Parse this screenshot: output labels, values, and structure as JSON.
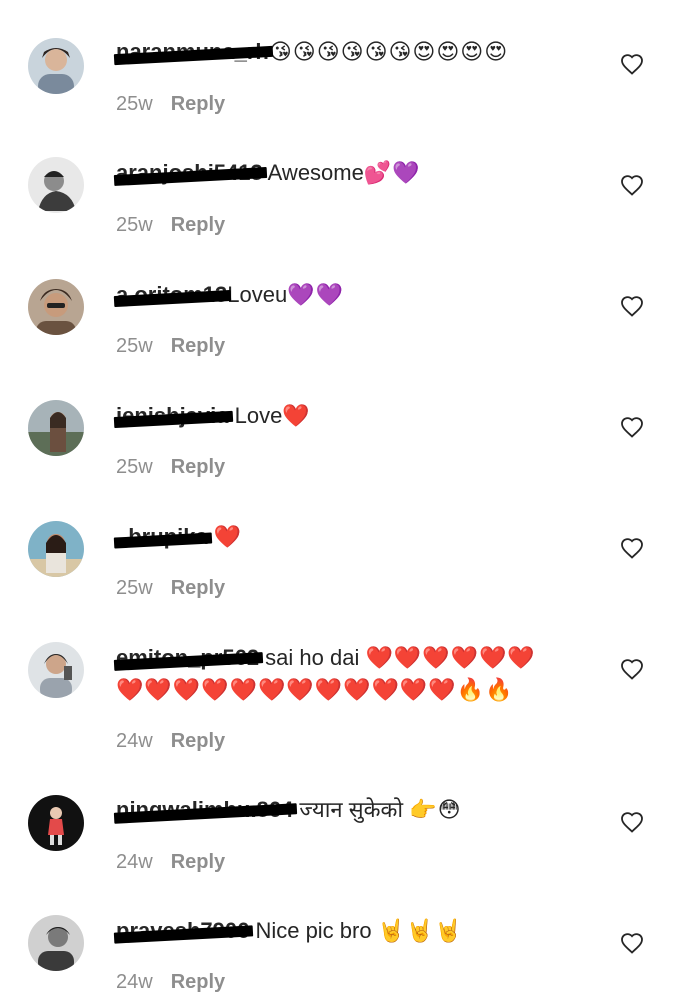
{
  "comments": [
    {
      "username": "naranmuna_rh",
      "text": "",
      "emoji": "😘😘😘😘😘😘😍😍😍😍",
      "time": "25w",
      "reply": "Reply",
      "avatar_color": "#7a8a9c"
    },
    {
      "username": "aranjoshi5413",
      "text": " Awesome",
      "emoji": "💕💜",
      "time": "25w",
      "reply": "Reply",
      "avatar_color": "#555555"
    },
    {
      "username": "a.oritom13",
      "text": "Loveu",
      "emoji": "💜💜",
      "time": "25w",
      "reply": "Reply",
      "avatar_color": "#8a6a55"
    },
    {
      "username": "jenishjavia",
      "text": " Love",
      "emoji": "❤️",
      "time": "25w",
      "reply": "Reply",
      "avatar_color": "#6c7a6a"
    },
    {
      "username": "_brupika",
      "text": " ",
      "emoji": "❤️",
      "time": "25w",
      "reply": "Reply",
      "avatar_color": "#5c93a8"
    },
    {
      "username": "emiton_pr562",
      "text": " sai ho dai ",
      "emoji": "❤️❤️❤️❤️❤️❤️",
      "emoji_line2": "❤️❤️❤️❤️❤️❤️❤️❤️❤️❤️❤️❤️🔥🔥",
      "time": "24w",
      "reply": "Reply",
      "avatar_color": "#9aa3ad"
    },
    {
      "username": "ningwalimbu.864",
      "text": " ज्यान सुकेको ",
      "emoji": "👉😳",
      "time": "24w",
      "reply": "Reply",
      "avatar_color": "#1a1a1a"
    },
    {
      "username": "pravesh7906",
      "text": " Nice pic bro ",
      "emoji": "🤘🤘🤘",
      "time": "24w",
      "reply": "Reply",
      "avatar_color": "#4a4a4a"
    }
  ]
}
